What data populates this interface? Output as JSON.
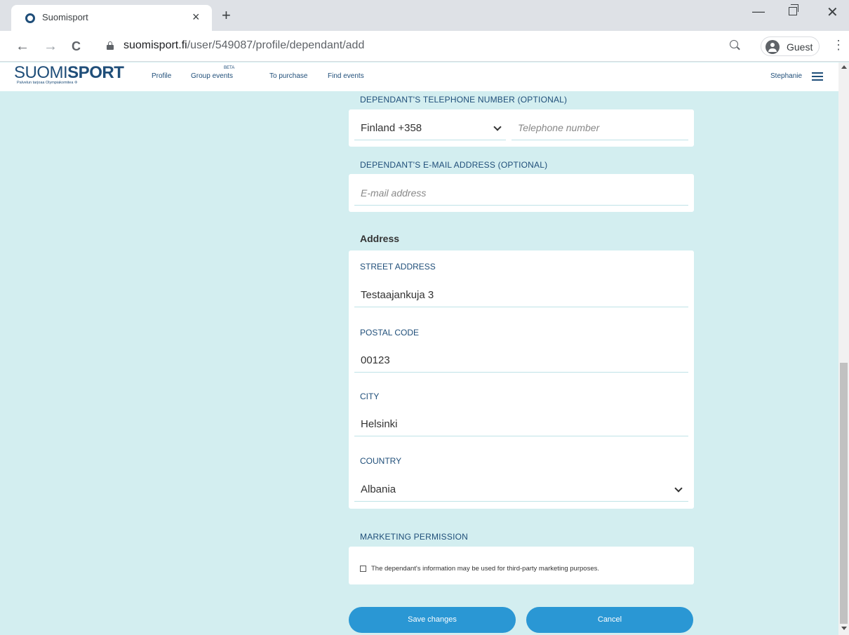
{
  "browser": {
    "tab_title": "Suomisport",
    "close_glyph": "×",
    "newtab_glyph": "+",
    "back_glyph": "←",
    "forward_glyph": "→",
    "reload_glyph": "C",
    "minimize_glyph": "—",
    "window_close_glyph": "✕",
    "menu_glyph": "⋮",
    "url_host": "suomisport.fi",
    "url_path": "/user/549087/profile/dependant/add",
    "profile_label": "Guest"
  },
  "site": {
    "logo_light": "SUOMI",
    "logo_bold": "SPORT",
    "logo_tagline": "Palvelun tarjoaa Olympiakomitea ✢",
    "nav": {
      "profile": "Profile",
      "group_events": "Group events",
      "beta_badge": "BETA",
      "to_purchase": "To purchase",
      "find_events": "Find events"
    },
    "user_name": "Stephanie"
  },
  "form": {
    "phone": {
      "label": "DEPENDANT'S TELEPHONE NUMBER (OPTIONAL)",
      "country_code": "Finland +358",
      "placeholder": "Telephone number"
    },
    "email": {
      "label": "DEPENDANT'S E-MAIL ADDRESS (OPTIONAL)",
      "placeholder": "E-mail address"
    },
    "address": {
      "heading": "Address",
      "street_label": "STREET ADDRESS",
      "street_value": "Testaajankuja 3",
      "postal_label": "POSTAL CODE",
      "postal_value": "00123",
      "city_label": "CITY",
      "city_value": "Helsinki",
      "country_label": "COUNTRY",
      "country_value": "Albania"
    },
    "marketing": {
      "label": "MARKETING PERMISSION",
      "checkbox_text": "The dependant's information may be used for third-party marketing purposes.",
      "checked": false
    },
    "buttons": {
      "save": "Save changes",
      "cancel": "Cancel"
    }
  },
  "colors": {
    "page_background": "#d3eef0",
    "brand": "#1f4e79",
    "button": "#2a97d4"
  }
}
